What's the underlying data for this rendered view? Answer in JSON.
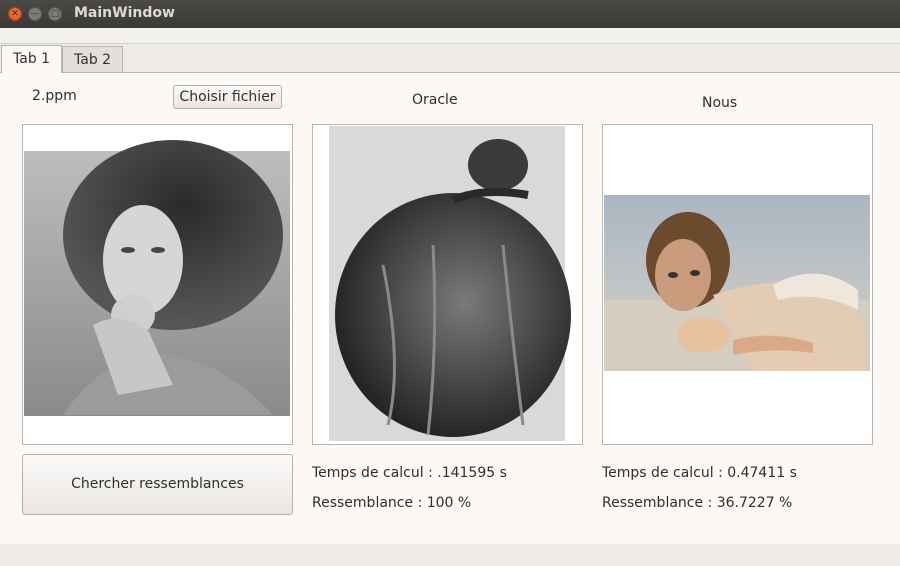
{
  "window": {
    "title": "MainWindow"
  },
  "tabs": [
    {
      "label": "Tab 1",
      "active": true
    },
    {
      "label": "Tab 2",
      "active": false
    }
  ],
  "left": {
    "filename": "2.ppm",
    "choose_button": "Choisir fichier",
    "search_button": "Chercher ressemblances",
    "image_icon": "portrait-photo"
  },
  "oracle": {
    "title": "Oracle",
    "time": "Temps de calcul : .141595 s",
    "similarity": "Ressemblance : 100 %",
    "image_icon": "snail-on-pumpkin-photo"
  },
  "nous": {
    "title": "Nous",
    "time": "Temps de calcul : 0.47411 s",
    "similarity": "Ressemblance : 36.7227 %",
    "image_icon": "woman-with-shell-photo"
  }
}
